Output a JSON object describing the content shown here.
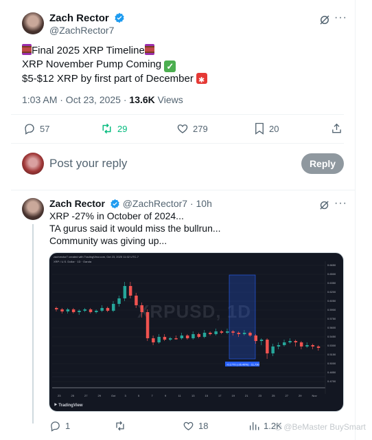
{
  "post": {
    "author_name": "Zach Rector",
    "author_handle": "@ZachRector7",
    "lines": [
      "Final 2025 XRP Timeline",
      "XRP November Pump Coming",
      "$5-$12 XRP by first part of December"
    ],
    "time": "1:03 AM · Oct 23, 2025 · ",
    "views_count": "13.6K",
    "views_label": " Views",
    "replies": "57",
    "reposts": "29",
    "likes": "279",
    "bookmarks": "20"
  },
  "composer": {
    "placeholder": "Post your reply",
    "button": "Reply"
  },
  "reply": {
    "author_name": "Zach Rector",
    "author_handle": "@ZachRector7",
    "age": "· 10h",
    "lines": [
      "XRP -27% in October of 2024...",
      "TA gurus said it would miss the bullrun...",
      "Community was giving up..."
    ],
    "replies": "1",
    "likes": "18",
    "views": "1.2K"
  },
  "chart": {
    "watermark": "XRPUSD, 1D",
    "brand": "TradingView",
    "symbol_line": "XRP / U.S. Dollar · 1D · Oanda",
    "x_labels": [
      "23",
      "25",
      "27",
      "29",
      "Oct",
      "3",
      "5",
      "7",
      "9",
      "11",
      "13",
      "15",
      "17",
      "19",
      "21",
      "23",
      "25",
      "27",
      "29",
      "Nov"
    ],
    "y_labels": [
      "0.6650",
      "0.6500",
      "0.6350",
      "0.6200",
      "0.6050",
      "0.5900",
      "0.5750",
      "0.5600",
      "0.5450",
      "0.5300",
      "0.5150",
      "0.5000",
      "0.4850",
      "0.4700"
    ],
    "measure_label": "-0.1770 (-26.49%) · 11,730",
    "up_color": "#26a69a",
    "down_color": "#ef5350"
  },
  "watermark_text": "@BeMaster BuySmart",
  "colors": {
    "green": "#00ba7c",
    "blue": "#1d9bf0"
  }
}
